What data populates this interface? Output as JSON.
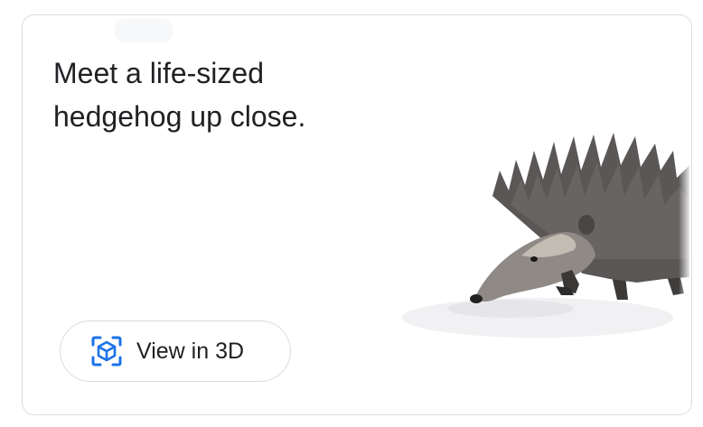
{
  "card": {
    "headline": "Meet a life-sized hedgehog up close.",
    "button": {
      "label": "View in 3D",
      "icon": "view-in-3d-icon"
    },
    "image": {
      "subject": "hedgehog"
    }
  },
  "colors": {
    "card_border": "#dadce0",
    "text": "#202124",
    "icon_blue": "#1a73e8"
  }
}
